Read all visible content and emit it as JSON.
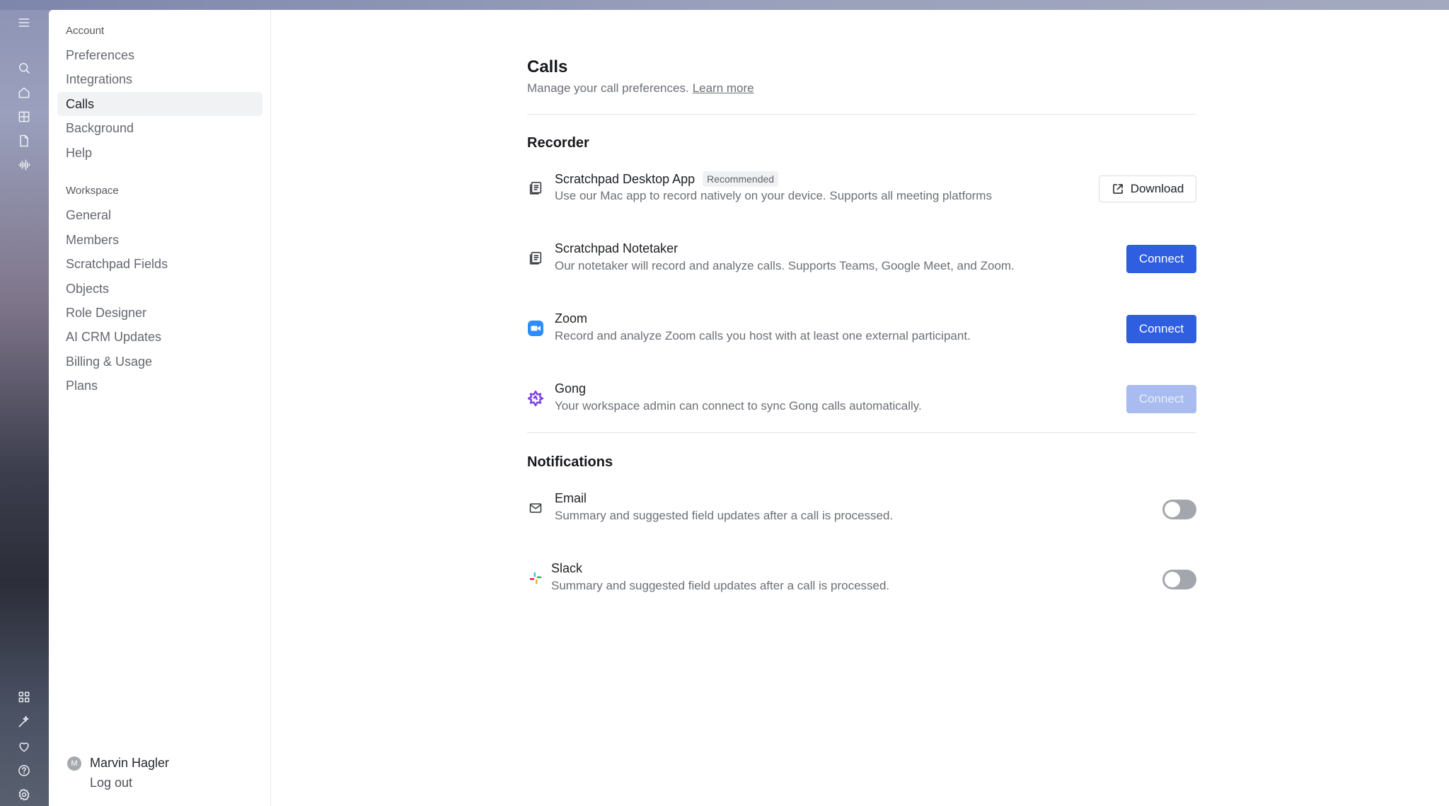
{
  "rail": {
    "top_icons": [
      "menu-icon",
      "search-icon",
      "home-icon",
      "grid-icon",
      "document-icon",
      "audio-wave-icon"
    ],
    "bottom_icons": [
      "apps-icon",
      "magic-wand-icon",
      "heart-icon",
      "help-icon",
      "settings-icon"
    ]
  },
  "sidebar": {
    "account_label": "Account",
    "account_items": [
      {
        "label": "Preferences"
      },
      {
        "label": "Integrations"
      },
      {
        "label": "Calls",
        "active": true
      },
      {
        "label": "Background"
      },
      {
        "label": "Help"
      }
    ],
    "workspace_label": "Workspace",
    "workspace_items": [
      {
        "label": "General"
      },
      {
        "label": "Members"
      },
      {
        "label": "Scratchpad Fields"
      },
      {
        "label": "Objects"
      },
      {
        "label": "Role Designer"
      },
      {
        "label": "AI CRM Updates"
      },
      {
        "label": "Billing & Usage"
      },
      {
        "label": "Plans"
      }
    ],
    "user": {
      "initial": "M",
      "name": "Marvin Hagler",
      "logout": "Log out"
    }
  },
  "main": {
    "title": "Calls",
    "subtitle": "Manage your call preferences.",
    "learn_more": "Learn more",
    "recorder": {
      "title": "Recorder",
      "items": [
        {
          "icon": "document-stack-icon",
          "title": "Scratchpad Desktop App",
          "badge": "Recommended",
          "desc": "Use our Mac app to record natively on your device. Supports all meeting platforms",
          "action": "Download"
        },
        {
          "icon": "document-stack-icon",
          "title": "Scratchpad Notetaker",
          "desc": "Our notetaker will record and analyze calls. Supports Teams, Google Meet, and Zoom.",
          "action": "Connect"
        },
        {
          "icon": "zoom-icon",
          "title": "Zoom",
          "desc": "Record and analyze Zoom calls you host with at least one external participant.",
          "action": "Connect"
        },
        {
          "icon": "gong-icon",
          "title": "Gong",
          "desc": "Your workspace admin can connect to sync Gong calls automatically.",
          "action": "Connect",
          "disabled": true
        }
      ]
    },
    "notifications": {
      "title": "Notifications",
      "items": [
        {
          "icon": "mail-icon",
          "title": "Email",
          "desc": "Summary and suggested field updates after a call is processed.",
          "enabled": false
        },
        {
          "icon": "slack-icon",
          "title": "Slack",
          "desc": "Summary and suggested field updates after a call is processed.",
          "enabled": false
        }
      ]
    }
  },
  "colors": {
    "primary": "#2f5fe0",
    "primary_disabled": "#a9bcf0",
    "zoom": "#2d8cff",
    "gong": "#7b3fe4"
  }
}
